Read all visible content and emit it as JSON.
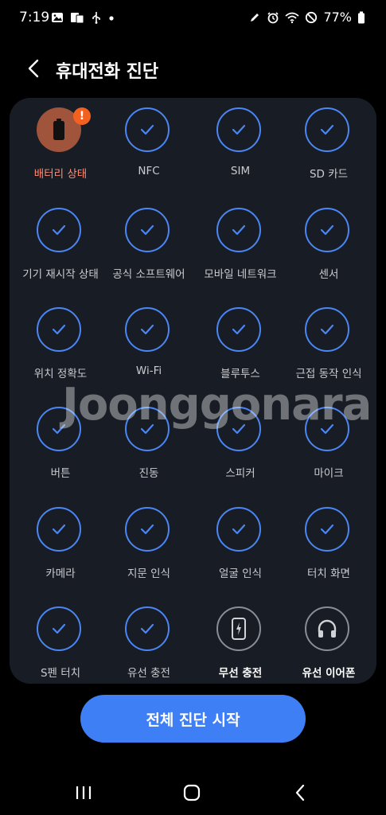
{
  "status_bar": {
    "time": "7:19",
    "battery": "77%"
  },
  "header": {
    "title": "휴대전화 진단"
  },
  "tests": [
    {
      "label": "배터리 상태",
      "state": "warning",
      "badge": "!"
    },
    {
      "label": "NFC",
      "state": "passed"
    },
    {
      "label": "SIM",
      "state": "passed"
    },
    {
      "label": "SD 카드",
      "state": "passed"
    },
    {
      "label": "기기 재시작 상태",
      "state": "passed"
    },
    {
      "label": "공식 소프트웨어",
      "state": "passed"
    },
    {
      "label": "모바일 네트워크",
      "state": "passed"
    },
    {
      "label": "센서",
      "state": "passed"
    },
    {
      "label": "위치 정확도",
      "state": "passed"
    },
    {
      "label": "Wi-Fi",
      "state": "passed"
    },
    {
      "label": "블루투스",
      "state": "passed"
    },
    {
      "label": "근접 동작 인식",
      "state": "passed"
    },
    {
      "label": "버튼",
      "state": "passed"
    },
    {
      "label": "진동",
      "state": "passed"
    },
    {
      "label": "스피커",
      "state": "passed"
    },
    {
      "label": "마이크",
      "state": "passed"
    },
    {
      "label": "카메라",
      "state": "passed"
    },
    {
      "label": "지문 인식",
      "state": "passed"
    },
    {
      "label": "얼굴 인식",
      "state": "passed"
    },
    {
      "label": "터치 화면",
      "state": "passed"
    },
    {
      "label": "S펜 터치",
      "state": "passed"
    },
    {
      "label": "유선 충전",
      "state": "passed"
    },
    {
      "label": "무선 충전",
      "state": "pending",
      "icon": "wireless-charging-icon"
    },
    {
      "label": "유선 이어폰",
      "state": "pending",
      "icon": "headphones-icon"
    }
  ],
  "watermark": "Joonggonara",
  "start_button": {
    "label": "전체 진단 시작"
  },
  "colors": {
    "accent": "#3f7ff6",
    "ring": "#4a86f4",
    "warning": "#f2611f",
    "card": "#181c24"
  }
}
